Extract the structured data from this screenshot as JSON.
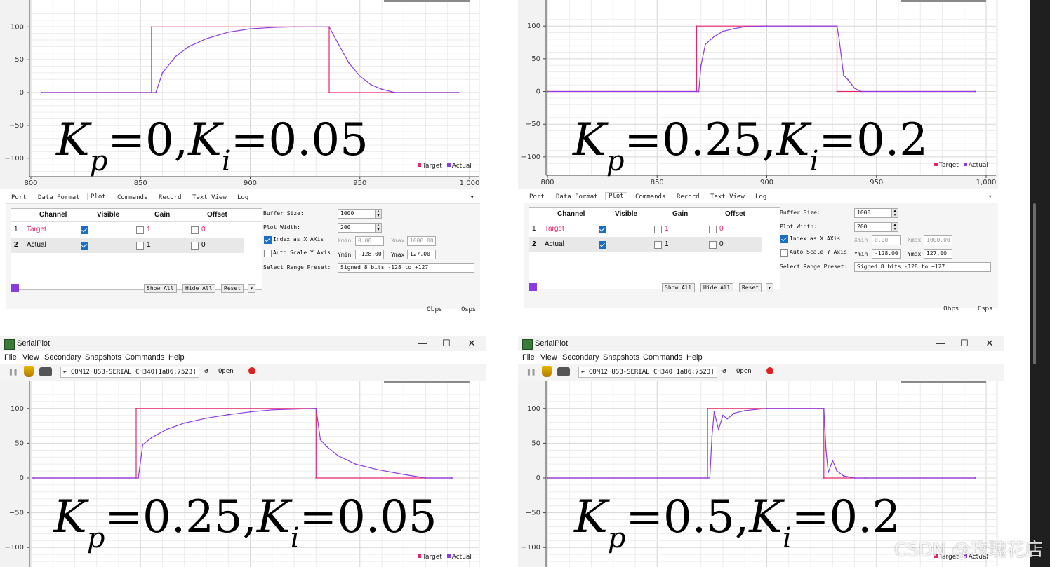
{
  "window": {
    "app_title": "SerialPlot",
    "menu": [
      "File",
      "View",
      "Secondary",
      "Snapshots",
      "Commands",
      "Help"
    ],
    "port_label": "COM12 USB-SERIAL CH340[1a86:7523]",
    "open_label": "Open",
    "minimize_icon": "—",
    "maximize_icon": "☐",
    "close_icon": "✕"
  },
  "tabs": [
    "Port",
    "Data Format",
    "Plot",
    "Commands",
    "Record",
    "Text View",
    "Log"
  ],
  "tabs_dropdown": "▾",
  "legend": {
    "target": "Target",
    "actual": "Actual",
    "target_color": "#e8246e",
    "actual_color": "#8a3be3"
  },
  "settings": {
    "col_channel": "Channel",
    "col_visible": "Visible",
    "col_gain": "Gain",
    "col_offset": "Offset",
    "rows": [
      {
        "num": "1",
        "name": "Target",
        "gain": "1",
        "offset": "0"
      },
      {
        "num": "2",
        "name": "Actual",
        "gain": "1",
        "offset": "0"
      }
    ],
    "buffer_size_label": "Buffer Size:",
    "buffer_size": "1000",
    "plot_width_label": "Plot Width:",
    "plot_width": "200",
    "index_x_label": "Index as X AXis",
    "xmin_label": "Xmin",
    "xmin": "0.00",
    "xmax_label": "Xmax",
    "xmax": "1000.00",
    "auto_scale_label": "Auto Scale Y Axis",
    "ymin_label": "Ymin",
    "ymin": "-128.00",
    "ymax_label": "Ymax",
    "ymax": "127.00",
    "range_preset_label": "Select Range Preset:",
    "range_preset": "Signed 8 bits -128 to +127",
    "show_all": "Show All",
    "hide_all": "Hide All",
    "reset": "Reset"
  },
  "status": {
    "bps": "0bps",
    "sps": "0sps"
  },
  "panels": [
    {
      "label_k": "K",
      "label_p": "p",
      "eq1": "=0,",
      "label_i": "i",
      "eq2": "=0.05"
    },
    {
      "label_k": "K",
      "label_p": "p",
      "eq1": "=0.25,",
      "label_i": "i",
      "eq2": "=0.2"
    },
    {
      "label_k": "K",
      "label_p": "p",
      "eq1": "=0.25,",
      "label_i": "i",
      "eq2": "=0.05"
    },
    {
      "label_k": "K",
      "label_p": "p",
      "eq1": "=0.5,",
      "label_i": "i",
      "eq2": "=0.2"
    }
  ],
  "watermark": "CSDN @玫瑰花店",
  "chart_data": [
    {
      "type": "line",
      "xlim": [
        800,
        1000
      ],
      "ylim": [
        -128,
        127
      ],
      "yticks": [
        100,
        50,
        0,
        -50,
        -100
      ],
      "xticks": [
        "800",
        "850",
        "900",
        "950",
        "1,000"
      ],
      "series": [
        {
          "name": "Target",
          "x": [
            805,
            855,
            855,
            936,
            936,
            995
          ],
          "y": [
            0,
            0,
            100,
            100,
            0,
            0
          ]
        },
        {
          "name": "Actual",
          "x": [
            805,
            857,
            860,
            866,
            872,
            880,
            890,
            900,
            910,
            920,
            936,
            940,
            945,
            950,
            955,
            960,
            966,
            995
          ],
          "y": [
            0,
            0,
            30,
            55,
            70,
            82,
            92,
            97,
            99,
            100,
            100,
            75,
            45,
            25,
            12,
            5,
            0,
            0
          ]
        }
      ]
    },
    {
      "type": "line",
      "xlim": [
        800,
        1000
      ],
      "ylim": [
        -128,
        127
      ],
      "yticks": [
        100,
        50,
        0,
        -50,
        -100
      ],
      "xticks": [
        "800",
        "850",
        "900",
        "950",
        "1,000"
      ],
      "series": [
        {
          "name": "Target",
          "x": [
            800,
            868,
            868,
            932,
            932,
            995
          ],
          "y": [
            0,
            0,
            100,
            100,
            0,
            0
          ]
        },
        {
          "name": "Actual",
          "x": [
            800,
            869,
            870,
            872,
            876,
            880,
            885,
            890,
            900,
            932,
            933,
            935,
            937,
            940,
            943,
            995
          ],
          "y": [
            0,
            0,
            40,
            72,
            84,
            92,
            96,
            99,
            100,
            100,
            80,
            25,
            18,
            5,
            0,
            0
          ]
        }
      ]
    },
    {
      "type": "line",
      "xlim": [
        800,
        1000
      ],
      "ylim": [
        -128,
        127
      ],
      "yticks": [
        100,
        50,
        0,
        -50,
        -100
      ],
      "xticks": [],
      "series": [
        {
          "name": "Target",
          "x": [
            801,
            848,
            848,
            930,
            930,
            992
          ],
          "y": [
            0,
            0,
            100,
            100,
            0,
            0
          ]
        },
        {
          "name": "Actual",
          "x": [
            801,
            849,
            851,
            855,
            862,
            870,
            880,
            890,
            900,
            910,
            930,
            932,
            935,
            940,
            948,
            958,
            970,
            980,
            992
          ],
          "y": [
            0,
            0,
            48,
            58,
            70,
            79,
            86,
            91,
            95,
            98,
            100,
            55,
            45,
            32,
            20,
            12,
            5,
            0,
            0
          ]
        }
      ]
    },
    {
      "type": "line",
      "xlim": [
        800,
        1000
      ],
      "ylim": [
        -128,
        127
      ],
      "yticks": [
        100,
        50,
        0,
        -50,
        -100
      ],
      "xticks": [],
      "series": [
        {
          "name": "Target",
          "x": [
            800,
            873,
            873,
            926,
            926,
            995
          ],
          "y": [
            0,
            0,
            100,
            100,
            0,
            0
          ]
        },
        {
          "name": "Actual",
          "x": [
            800,
            874,
            875,
            876,
            878,
            880,
            882,
            885,
            890,
            900,
            926,
            927,
            928,
            930,
            932,
            935,
            940,
            945,
            995
          ],
          "y": [
            0,
            0,
            60,
            95,
            70,
            90,
            85,
            93,
            97,
            100,
            100,
            40,
            8,
            25,
            10,
            3,
            0,
            0,
            0
          ]
        }
      ]
    }
  ]
}
